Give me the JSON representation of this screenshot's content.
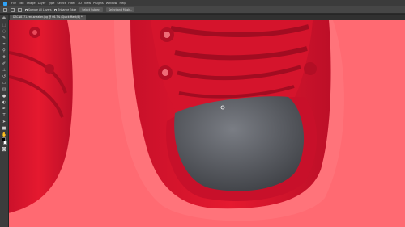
{
  "menubar": {
    "items": [
      "File",
      "Edit",
      "Image",
      "Layer",
      "Type",
      "Select",
      "Filter",
      "3D",
      "View",
      "Plugins",
      "Window",
      "Help"
    ]
  },
  "options": {
    "sample_all_layers": "Sample All Layers",
    "enhance_edge": "Enhance Edge",
    "select_subject": "Select Subject",
    "select_mask": "Select and Mask..."
  },
  "document": {
    "tab_title": "DSCN8171-red-sneaker.jpg @ 66.7% (Quick Mask/8) *"
  },
  "colors": {
    "overlay": "#ff6a72",
    "shoe_red": "#e0172e",
    "insole": "#5b5d63",
    "chrome": "#3c3c3c"
  },
  "tools": [
    "move-tool-icon",
    "marquee-tool-icon",
    "lasso-tool-icon",
    "quick-select-tool-icon",
    "crop-tool-icon",
    "eyedropper-tool-icon",
    "healing-tool-icon",
    "brush-tool-icon",
    "stamp-tool-icon",
    "history-brush-icon",
    "eraser-tool-icon",
    "gradient-tool-icon",
    "blur-tool-icon",
    "dodge-tool-icon",
    "pen-tool-icon",
    "type-tool-icon",
    "path-select-tool-icon",
    "shape-tool-icon",
    "hand-tool-icon",
    "zoom-tool-icon"
  ]
}
